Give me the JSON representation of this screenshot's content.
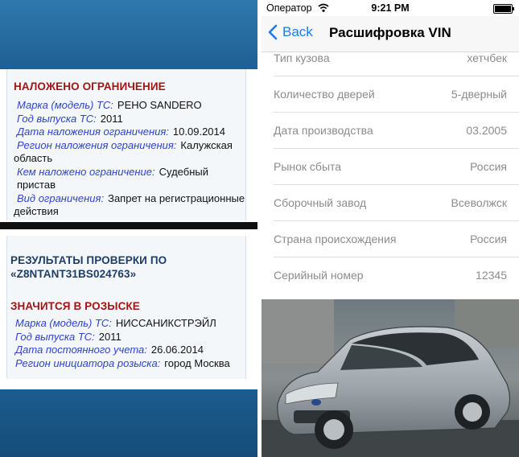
{
  "left": {
    "restriction": {
      "title": "НАЛОЖЕНО ОГРАНИЧЕНИЕ",
      "rows": [
        {
          "key": "Марка (модель) ТС:",
          "value": "РЕНО SANDERO"
        },
        {
          "key": "Год выпуска ТС:",
          "value": "2011"
        },
        {
          "key": "Дата наложения ограничения:",
          "value": "10.09.2014"
        },
        {
          "key": "Регион наложения ограничения:",
          "value": "Калужская",
          "value2": "область"
        },
        {
          "key": "Кем наложено ограничение:",
          "value": "Судебный пристав"
        },
        {
          "key": "Вид ограничения:",
          "value": "Запрет на регистрационные",
          "value2": "действия"
        }
      ]
    },
    "results": {
      "title_line1": "РЕЗУЛЬТАТЫ ПРОВЕРКИ ПО",
      "title_line2": "«Z8NTANT31BS024763»"
    },
    "wanted": {
      "title": "ЗНАЧИТСЯ В РОЗЫСКЕ",
      "rows": [
        {
          "key": "Марка (модель) ТС:",
          "value": "НИССАНИКСТРЭЙЛ"
        },
        {
          "key": "Год выпуска ТС:",
          "value": "2011"
        },
        {
          "key": "Дата постоянного учета:",
          "value": "26.06.2014"
        },
        {
          "key": "Регион инициатора розыска:",
          "value": "город Москва"
        }
      ]
    }
  },
  "right": {
    "status": {
      "carrier": "Оператор",
      "time": "9:21 PM"
    },
    "nav": {
      "back_label": "Back",
      "title": "Расшифровка VIN"
    },
    "rows": [
      {
        "key": "Тип кузова",
        "value": "хетчбек"
      },
      {
        "key": "Количество дверей",
        "value": "5-дверный"
      },
      {
        "key": "Дата производства",
        "value": "03.2005"
      },
      {
        "key": "Рынок сбыта",
        "value": "Россия"
      },
      {
        "key": "Сборочный завод",
        "value": "Всеволжск"
      },
      {
        "key": "Страна происхождения",
        "value": "Россия"
      },
      {
        "key": "Серийный номер",
        "value": "12345"
      }
    ]
  },
  "colors": {
    "accent_blue": "#1b7cf5",
    "section_red": "#a11515",
    "label_blue": "#2f43c9",
    "header_navy": "#1d3d66"
  },
  "icons": [
    "wifi-icon",
    "battery-icon",
    "chevron-left-icon"
  ]
}
